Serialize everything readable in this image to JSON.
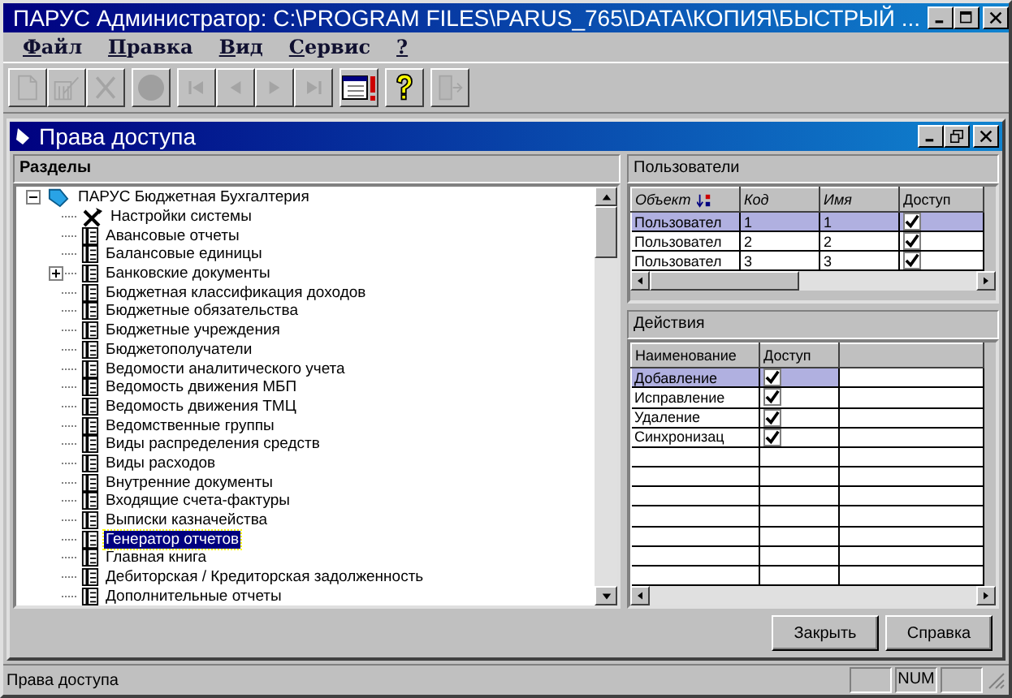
{
  "window": {
    "title": "ПАРУС Администратор: C:\\PROGRAM FILES\\PARUS_765\\DATA\\КОПИЯ\\БЫСТРЫЙ ..."
  },
  "menu": [
    "Файл",
    "Правка",
    "Вид",
    "Сервис",
    "?"
  ],
  "toolbar": [
    {
      "kind": "new",
      "disabled": true
    },
    {
      "kind": "edit",
      "disabled": true
    },
    {
      "kind": "delete",
      "disabled": true
    },
    {
      "kind": "record",
      "disabled": true
    },
    {
      "kind": "first",
      "disabled": true
    },
    {
      "kind": "prev",
      "disabled": true
    },
    {
      "kind": "next",
      "disabled": true
    },
    {
      "kind": "last",
      "disabled": true
    },
    {
      "kind": "calendar",
      "disabled": false
    },
    {
      "kind": "help",
      "disabled": false
    },
    {
      "kind": "exit",
      "disabled": true
    }
  ],
  "child_window": {
    "title": "Права доступа"
  },
  "sections": {
    "header": "Разделы",
    "tree": [
      {
        "label": "ПАРУС Бюджетная Бухгалтерия",
        "kind": "root",
        "expanded": true,
        "selected": false,
        "children": [
          {
            "label": "Настройки системы",
            "kind": "tools",
            "selected": false
          },
          {
            "label": "Авансовые отчеты",
            "kind": "book",
            "selected": false
          },
          {
            "label": "Балансовые единицы",
            "kind": "book",
            "selected": false
          },
          {
            "label": "Банковские документы",
            "kind": "book",
            "expanded": false,
            "selected": false
          },
          {
            "label": "Бюджетная классификация доходов",
            "kind": "book",
            "selected": false
          },
          {
            "label": "Бюджетные обязательства",
            "kind": "book",
            "selected": false
          },
          {
            "label": "Бюджетные учреждения",
            "kind": "book",
            "selected": false
          },
          {
            "label": "Бюджетополучатели",
            "kind": "book",
            "selected": false
          },
          {
            "label": "Ведомости аналитического учета",
            "kind": "book",
            "selected": false
          },
          {
            "label": "Ведомость движения МБП",
            "kind": "book",
            "selected": false
          },
          {
            "label": "Ведомость движения ТМЦ",
            "kind": "book",
            "selected": false
          },
          {
            "label": "Ведомственные группы",
            "kind": "book",
            "selected": false
          },
          {
            "label": "Виды распределения средств",
            "kind": "book",
            "selected": false
          },
          {
            "label": "Виды расходов",
            "kind": "book",
            "selected": false
          },
          {
            "label": "Внутренние документы",
            "kind": "book",
            "selected": false
          },
          {
            "label": "Входящие счета-фактуры",
            "kind": "book",
            "selected": false
          },
          {
            "label": "Выписки казначейства",
            "kind": "book",
            "selected": false
          },
          {
            "label": "Генератор отчетов",
            "kind": "book",
            "selected": true
          },
          {
            "label": "Главная книга",
            "kind": "book",
            "selected": false
          },
          {
            "label": "Дебиторская / Кредиторская задолженность",
            "kind": "book",
            "selected": false
          },
          {
            "label": "Дополнительные отчеты",
            "kind": "book",
            "selected": false
          }
        ]
      }
    ]
  },
  "users": {
    "header": "Пользователи",
    "columns": [
      "Объект",
      "Код",
      "Имя",
      "Доступ"
    ],
    "rows": [
      {
        "object": "Пользовател",
        "code": "1",
        "name": "1",
        "access": true,
        "selected": true
      },
      {
        "object": "Пользовател",
        "code": "2",
        "name": "2",
        "access": true,
        "selected": false
      },
      {
        "object": "Пользовател",
        "code": "3",
        "name": "3",
        "access": true,
        "selected": false
      }
    ]
  },
  "actions": {
    "header": "Действия",
    "columns": [
      "Наименование",
      "Доступ"
    ],
    "rows": [
      {
        "name": "Добавление",
        "access": true,
        "selected": true
      },
      {
        "name": "Исправление",
        "access": true,
        "selected": false
      },
      {
        "name": "Удаление",
        "access": true,
        "selected": false
      },
      {
        "name": "Синхронизац",
        "access": true,
        "selected": false
      }
    ]
  },
  "buttons": [
    "Закрыть",
    "Справка"
  ],
  "status_bar": {
    "text": "Права доступа",
    "indicator": "NUM"
  }
}
